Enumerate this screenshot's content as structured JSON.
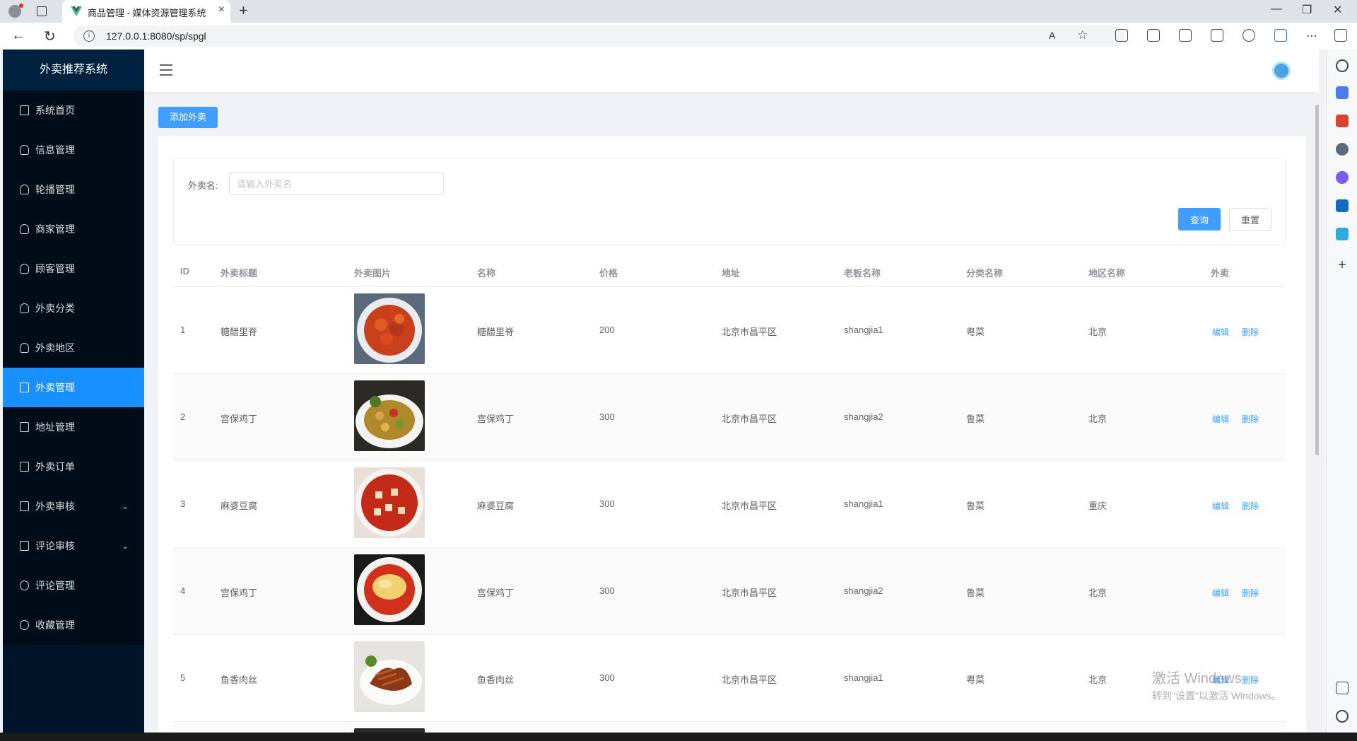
{
  "browser": {
    "tab_title": "商品管理 - 媒体资源管理系统",
    "url": "127.0.0.1:8080/sp/spgl"
  },
  "sidebar": {
    "brand": "外卖推荐系统",
    "items": [
      {
        "label": "系统首页",
        "icon": "home-icon"
      },
      {
        "label": "信息管理",
        "icon": "user-icon"
      },
      {
        "label": "轮播管理",
        "icon": "user-icon"
      },
      {
        "label": "商家管理",
        "icon": "user-icon"
      },
      {
        "label": "顾客管理",
        "icon": "user-icon"
      },
      {
        "label": "外卖分类",
        "icon": "user-icon"
      },
      {
        "label": "外卖地区",
        "icon": "user-icon"
      },
      {
        "label": "外卖管理",
        "icon": "book-icon",
        "active": true
      },
      {
        "label": "地址管理",
        "icon": "book-icon"
      },
      {
        "label": "外卖订单",
        "icon": "book-icon"
      },
      {
        "label": "外卖审核",
        "icon": "book-icon",
        "expandable": true
      },
      {
        "label": "评论审核",
        "icon": "document-icon",
        "expandable": true
      },
      {
        "label": "评论管理",
        "icon": "chat-icon"
      },
      {
        "label": "收藏管理",
        "icon": "chat-icon"
      }
    ]
  },
  "toolbar": {
    "add_label": "添加外卖"
  },
  "search": {
    "label": "外卖名:",
    "placeholder": "请输入外卖名",
    "query_label": "查询",
    "reset_label": "重置"
  },
  "table": {
    "headers": [
      "ID",
      "外卖标题",
      "外卖图片",
      "名称",
      "价格",
      "地址",
      "老板名称",
      "分类名称",
      "地区名称",
      "外卖"
    ],
    "edit_label": "编辑",
    "delete_label": "删除",
    "rows": [
      {
        "id": "1",
        "title": "糖醋里脊",
        "name": "糖醋里脊",
        "price": "200",
        "address": "北京市昌平区",
        "owner": "shangjia1",
        "category": "粤菜",
        "region": "北京"
      },
      {
        "id": "2",
        "title": "宫保鸡丁",
        "name": "宫保鸡丁",
        "price": "300",
        "address": "北京市昌平区",
        "owner": "shangjia2",
        "category": "鲁菜",
        "region": "北京"
      },
      {
        "id": "3",
        "title": "麻婆豆腐",
        "name": "麻婆豆腐",
        "price": "300",
        "address": "北京市昌平区",
        "owner": "shangjia1",
        "category": "鲁菜",
        "region": "重庆"
      },
      {
        "id": "4",
        "title": "宫保鸡丁",
        "name": "宫保鸡丁",
        "price": "300",
        "address": "北京市昌平区",
        "owner": "shangjia2",
        "category": "鲁菜",
        "region": "北京"
      },
      {
        "id": "5",
        "title": "鱼香肉丝",
        "name": "鱼香肉丝",
        "price": "300",
        "address": "北京市昌平区",
        "owner": "shangjia1",
        "category": "粤菜",
        "region": "北京"
      }
    ]
  },
  "watermark": {
    "line1": "激活 Windows",
    "line2": "转到\"设置\"以激活 Windows。"
  }
}
